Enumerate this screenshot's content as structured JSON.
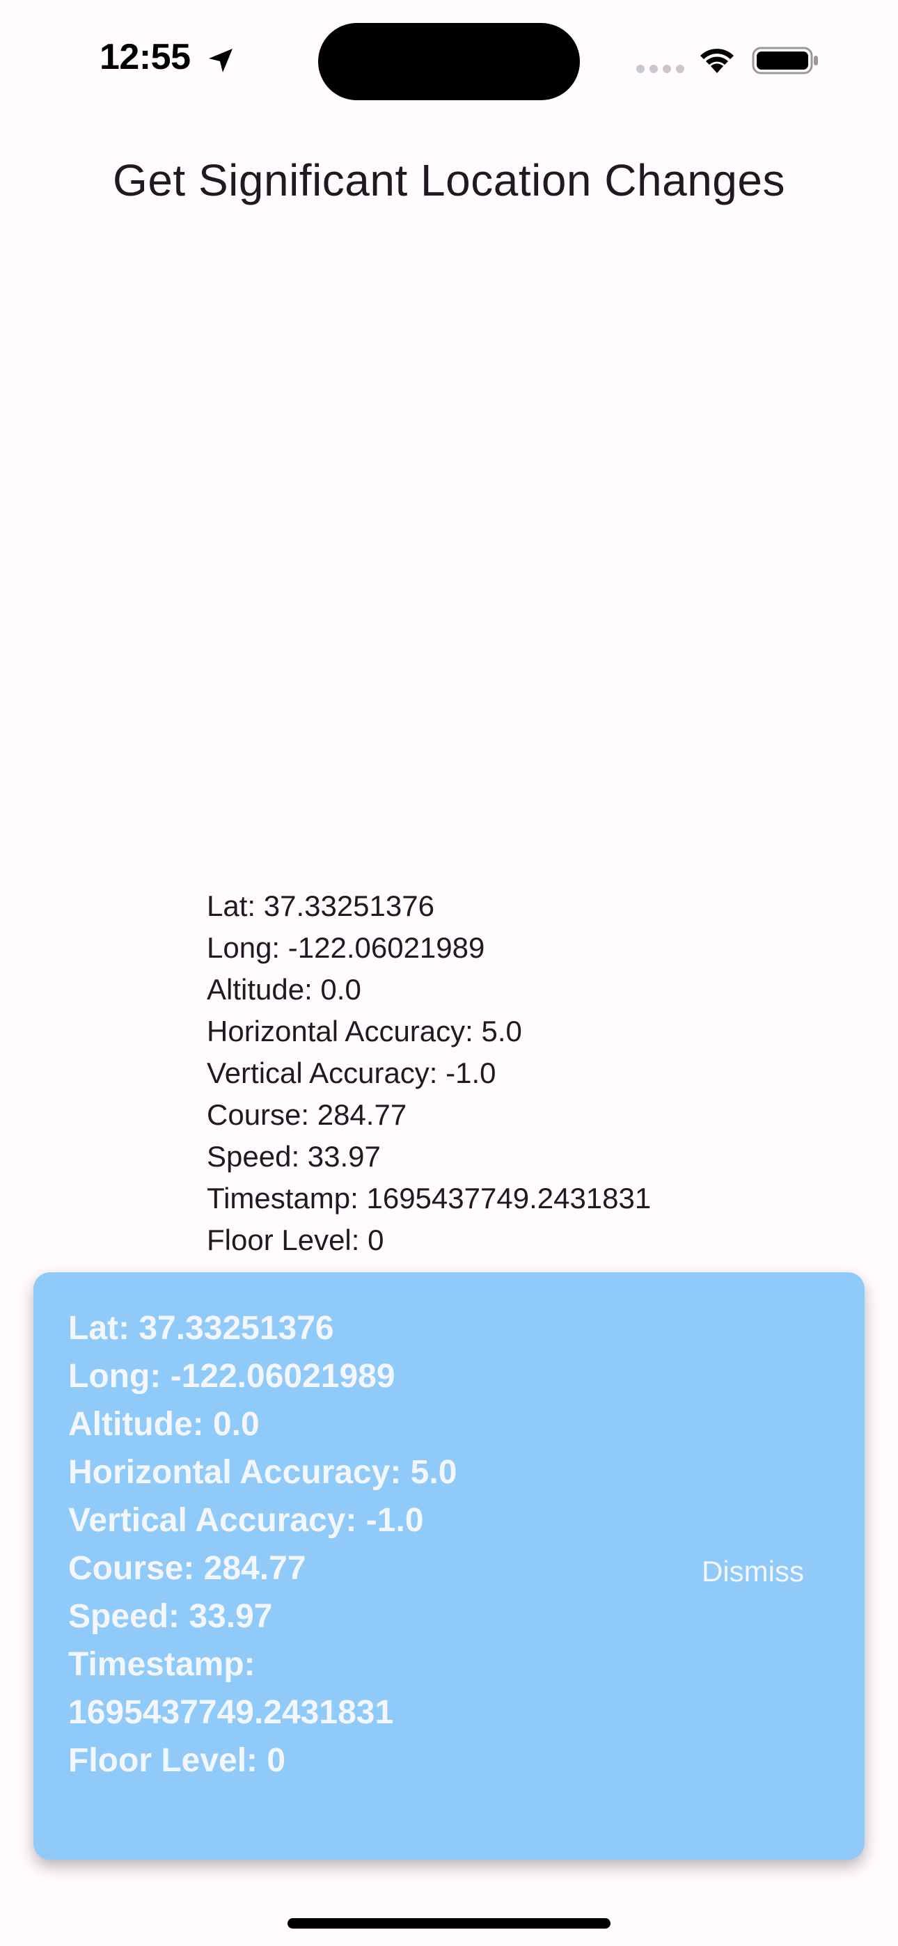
{
  "status_bar": {
    "time": "12:55",
    "icons": [
      "location-arrow-icon",
      "cellular-signal-icon",
      "wifi-icon",
      "battery-icon"
    ]
  },
  "app": {
    "title": "Get Significant Location Changes"
  },
  "location_info": [
    "Lat: 37.33251376",
    "Long: -122.06021989",
    "Altitude: 0.0",
    "Horizontal Accuracy: 5.0",
    "Vertical Accuracy: -1.0",
    "Course: 284.77",
    "Speed: 33.97",
    "Timestamp: 1695437749.2431831",
    "Floor Level: 0"
  ],
  "snackbar": {
    "lines": [
      "Lat: 37.33251376",
      "Long: -122.06021989",
      "Altitude: 0.0",
      "Horizontal Accuracy: 5.0",
      "Vertical Accuracy: -1.0",
      "Course: 284.77",
      "Speed: 33.97",
      "Timestamp:",
      "1695437749.2431831",
      "Floor Level: 0"
    ],
    "action_label": "Dismiss",
    "background_color": "#90caf9"
  }
}
